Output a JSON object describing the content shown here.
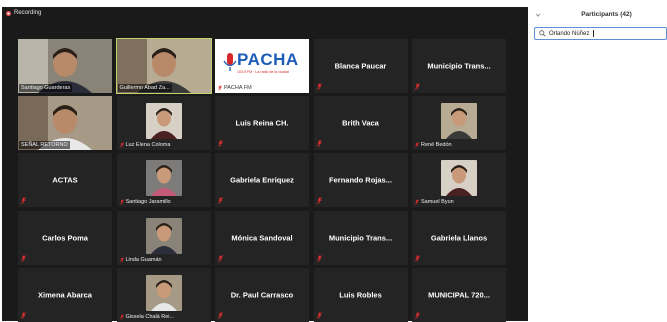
{
  "recording": {
    "label": "Recording"
  },
  "participants_panel": {
    "title": "Participants (42)",
    "search": {
      "value": "Orlando Núñez"
    }
  },
  "tiles": [
    {
      "kind": "video",
      "label": "Santiago Guarderas"
    },
    {
      "kind": "video",
      "label": "Guillermo Abad Za...",
      "active": true
    },
    {
      "kind": "logo",
      "label": "PACHA FM",
      "logo_text": "PACHA",
      "logo_sub": "103.9 FM · La radio de la ciudad"
    },
    {
      "kind": "name",
      "name": "Blanca Paucar"
    },
    {
      "kind": "name",
      "name": "Municipio Trans..."
    },
    {
      "kind": "video",
      "label": "SEÑAL RETORNO"
    },
    {
      "kind": "thumb",
      "label": "Luz Elena Coloma"
    },
    {
      "kind": "name",
      "name": "Luis Reina CH."
    },
    {
      "kind": "name",
      "name": "Brith Vaca"
    },
    {
      "kind": "thumb",
      "label": "René Bedón"
    },
    {
      "kind": "name",
      "name": "ACTAS"
    },
    {
      "kind": "thumb",
      "label": "Santiago Jaramillo"
    },
    {
      "kind": "name",
      "name": "Gabriela Enriquez"
    },
    {
      "kind": "name",
      "name": "Fernando Rojas..."
    },
    {
      "kind": "thumb",
      "label": "Samuel Byun"
    },
    {
      "kind": "name",
      "name": "Carlos Poma"
    },
    {
      "kind": "thumb",
      "label": "Linda Guamán"
    },
    {
      "kind": "name",
      "name": "Mónica Sandoval"
    },
    {
      "kind": "name",
      "name": "Municipio Trans..."
    },
    {
      "kind": "name",
      "name": "Gabriela Llanos"
    },
    {
      "kind": "name",
      "name": "Ximena Abarca"
    },
    {
      "kind": "thumb",
      "label": "Gissela Chalá Rei..."
    },
    {
      "kind": "name",
      "name": "Dr. Paul Carrasco"
    },
    {
      "kind": "name",
      "name": "Luis Robles"
    },
    {
      "kind": "name",
      "name": "MUNICIPAL 720..."
    }
  ],
  "colors": {
    "tile_bg": "#242424",
    "active_border": "#c2d16a",
    "mute_red": "#e02f2f",
    "search_border": "#5b8fd8",
    "pacha_blue": "#1d5bb8",
    "pacha_red": "#d62828"
  }
}
